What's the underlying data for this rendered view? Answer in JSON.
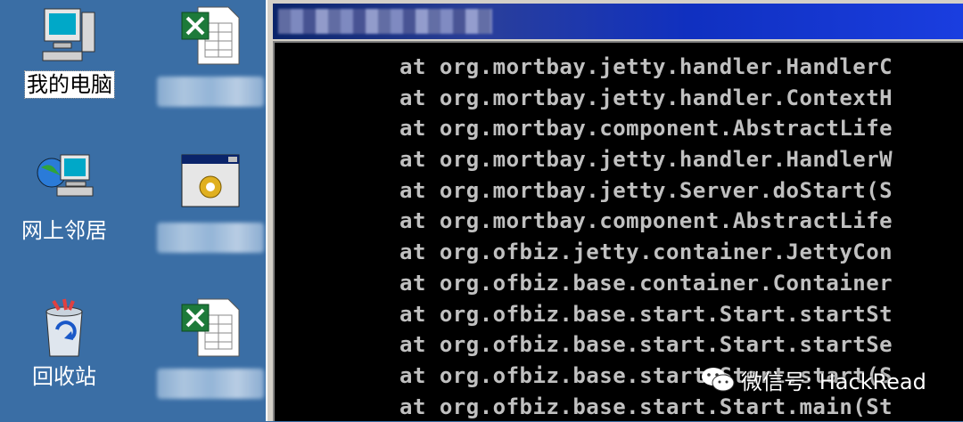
{
  "desktop": {
    "icons": [
      {
        "label": "我的电脑",
        "icon": "my-computer-icon"
      },
      {
        "label": "",
        "icon": "excel-file-icon"
      },
      {
        "label": "网上邻居",
        "icon": "network-neighborhood-icon"
      },
      {
        "label": "",
        "icon": "console-app-icon"
      },
      {
        "label": "回收站",
        "icon": "recycle-bin-icon"
      },
      {
        "label": "",
        "icon": "excel-file-icon"
      }
    ]
  },
  "console": {
    "lines": [
      "at org.mortbay.jetty.handler.HandlerC",
      "at org.mortbay.jetty.handler.ContextH",
      "at org.mortbay.component.AbstractLife",
      "at org.mortbay.jetty.handler.HandlerW",
      "at org.mortbay.jetty.Server.doStart(S",
      "at org.mortbay.component.AbstractLife",
      "at org.ofbiz.jetty.container.JettyCon",
      "at org.ofbiz.base.container.Container",
      "at org.ofbiz.base.start.Start.startSt",
      "at org.ofbiz.base.start.Start.startSe",
      "at org.ofbiz.base.start.Start.start(S",
      "at org.ofbiz.base.start.Start.main(St"
    ]
  },
  "watermark": {
    "text": "微信号: HackRead",
    "icon": "wechat-logo-icon"
  },
  "colors": {
    "desktop": "#3a6ea5",
    "console_bg": "#000000",
    "console_text": "#c0c0c0",
    "titlebar": "#0a246a"
  }
}
